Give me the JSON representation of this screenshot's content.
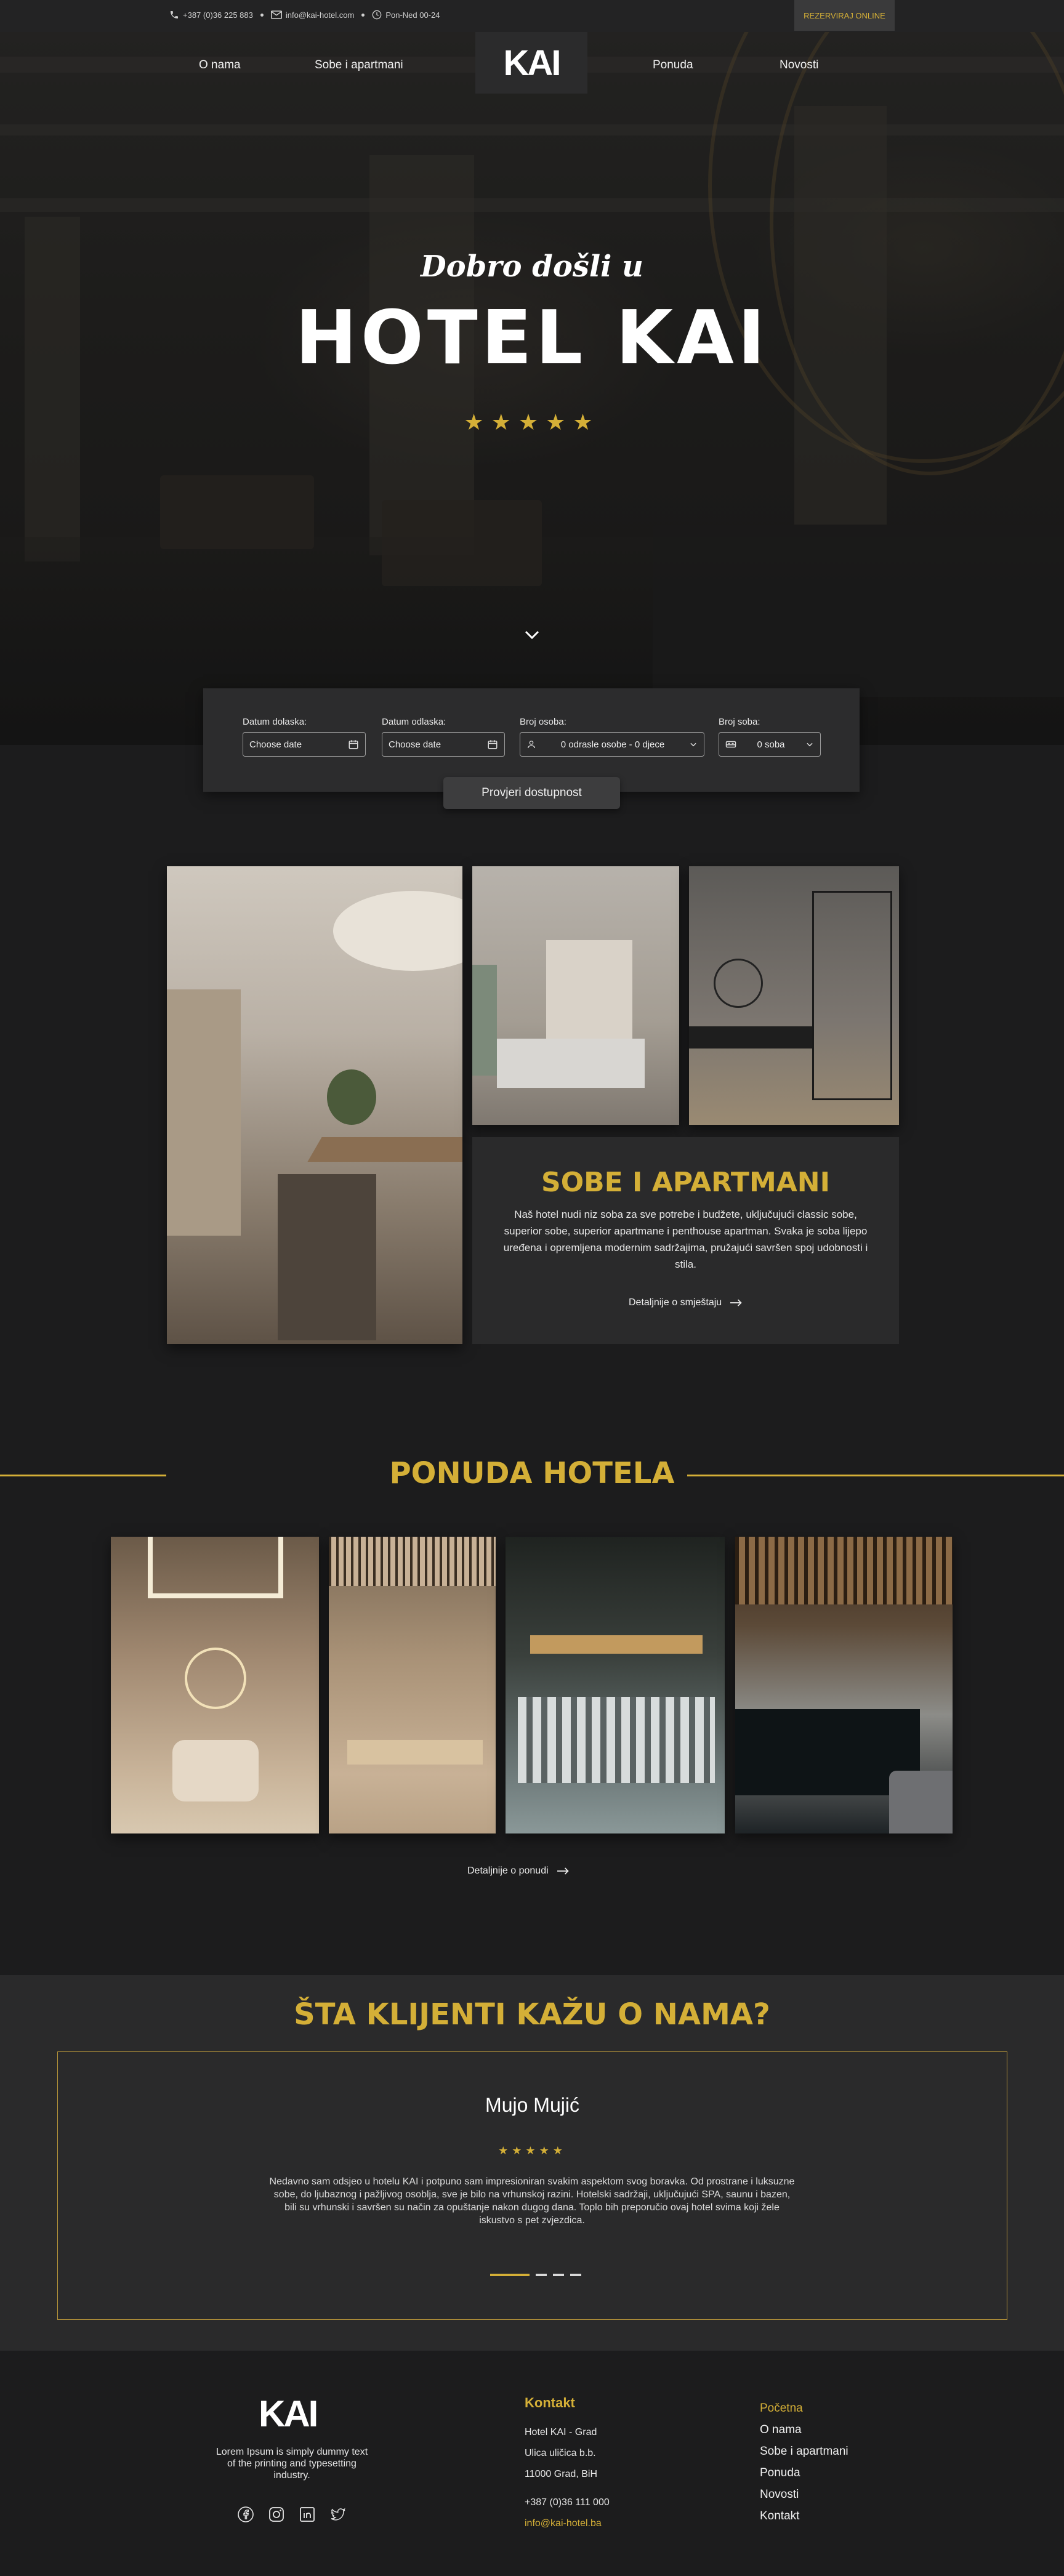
{
  "topbar": {
    "phone": "+387 (0)36 225 883",
    "email": "info@kai-hotel.com",
    "hours": "Pon-Ned 00-24",
    "reserve_label": "REZERVIRAJ ONLINE"
  },
  "nav": {
    "about": "O nama",
    "rooms": "Sobe i apartmani",
    "logo": "KAI",
    "offer": "Ponuda",
    "news": "Novosti"
  },
  "hero": {
    "welcome": "Dobro došli u",
    "title": "HOTEL KAI",
    "stars": "★★★★★"
  },
  "booking": {
    "arrival_label": "Datum dolaska:",
    "arrival_placeholder": "Choose date",
    "departure_label": "Datum odlaska:",
    "departure_placeholder": "Choose date",
    "guests_label": "Broj osoba:",
    "guests_value": "0 odrasle osobe - 0 djece",
    "rooms_label": "Broj soba:",
    "rooms_value": "0  soba",
    "check_button": "Provjeri dostupnost"
  },
  "rooms": {
    "title": "SOBE I APARTMANI",
    "description": "Naš hotel nudi niz soba za sve potrebe i budžete, uključujući classic sobe, superior sobe, superior apartmane i penthouse apartman. Svaka je soba lijepo uređena i opremljena modernim sadržajima, pružajući savršen spoj udobnosti i stila.",
    "link": "Detaljnije o smještaju"
  },
  "offer": {
    "title": "PONUDA HOTELA",
    "link": "Detaljnije o ponudi"
  },
  "testimonials": {
    "title": "ŠTA KLIJENTI KAŽU O NAMA?",
    "name": "Mujo Mujić",
    "stars": "★★★★★",
    "quote": "Nedavno sam odsjeo u hotelu KAI i potpuno sam impresioniran svakim aspektom svog boravka. Od prostrane i luksuzne sobe, do ljubaznog i pažljivog osoblja, sve je bilo na vrhunskoj razini. Hotelski sadržaji, uključujući SPA, saunu i bazen, bili su vrhunski i savršen su način za opuštanje nakon dugog dana. Toplo bih preporučio ovaj hotel svima koji žele iskustvo s pet zvjezdica."
  },
  "footer": {
    "logo": "KAI",
    "text": "Lorem Ipsum is simply dummy text of the printing and typesetting industry.",
    "contact_title": "Kontakt",
    "address1": "Hotel KAI - Grad",
    "address2": "Ulica uličica b.b.",
    "address3": "11000 Grad, BiH",
    "phone": "+387 (0)36 111 000",
    "email": "info@kai-hotel.ba",
    "links": [
      "Početna",
      "O nama",
      "Sobe i apartmani",
      "Ponuda",
      "Novosti",
      "Kontakt"
    ]
  },
  "colors": {
    "accent": "#d4af37",
    "background": "#1c1c1d",
    "panel": "#2a2a2b"
  }
}
